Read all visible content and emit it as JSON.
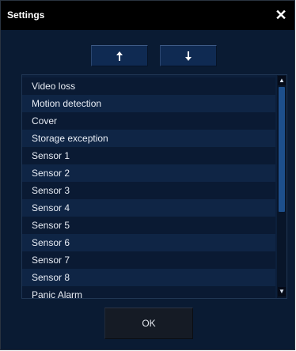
{
  "dialog": {
    "title": "Settings",
    "close_label": "✕",
    "ok_label": "OK",
    "up_icon": "arrow-up-icon",
    "down_icon": "arrow-down-icon"
  },
  "list": {
    "items": [
      "Video loss",
      "Motion detection",
      "Cover",
      "Storage exception",
      "Sensor 1",
      "Sensor 2",
      "Sensor 3",
      "Sensor 4",
      "Sensor 5",
      "Sensor 6",
      "Sensor 7",
      "Sensor 8",
      "Panic Alarm"
    ],
    "scroll_position_fraction": 0.0
  },
  "colors": {
    "background": "#0a1b33",
    "titlebar": "#000000",
    "scroll_thumb": "#1d4f8c"
  }
}
